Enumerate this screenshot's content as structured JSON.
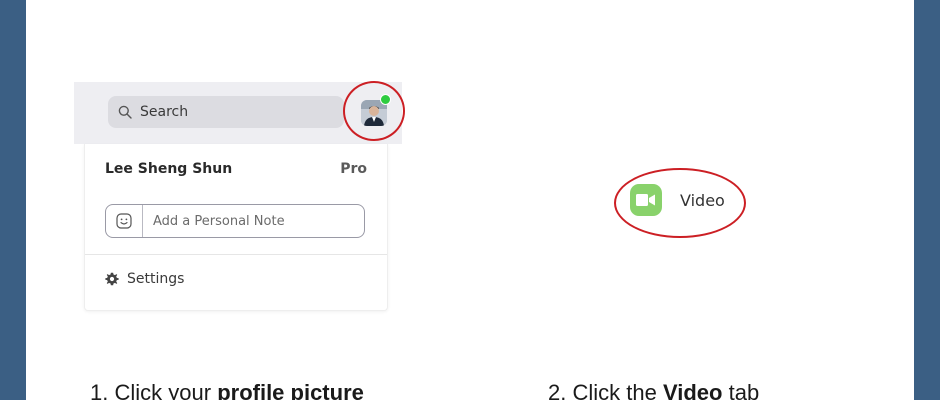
{
  "colors": {
    "frame": "#3b5f84",
    "highlight": "#cc1f24",
    "video_icon_bg": "#89d26b",
    "presence": "#2ecc40"
  },
  "zoom_mockup": {
    "search": {
      "icon": "search-icon",
      "label": "Search"
    },
    "avatar": {
      "icon": "profile-avatar",
      "presence": "online"
    },
    "profile_card": {
      "user_name": "Lee Sheng Shun",
      "plan": "Pro",
      "note_input": {
        "icon": "smiley-icon",
        "placeholder": "Add a Personal Note"
      },
      "settings": {
        "icon": "gear-icon",
        "label": "Settings"
      }
    }
  },
  "video_tab": {
    "icon": "video-camera-icon",
    "label": "Video"
  },
  "steps": [
    {
      "number": "1.",
      "prefix": "Click your",
      "bold": "profile picture",
      "suffix": ""
    },
    {
      "number": "2.",
      "prefix": "Click the",
      "bold": "Video",
      "suffix": "tab"
    }
  ]
}
